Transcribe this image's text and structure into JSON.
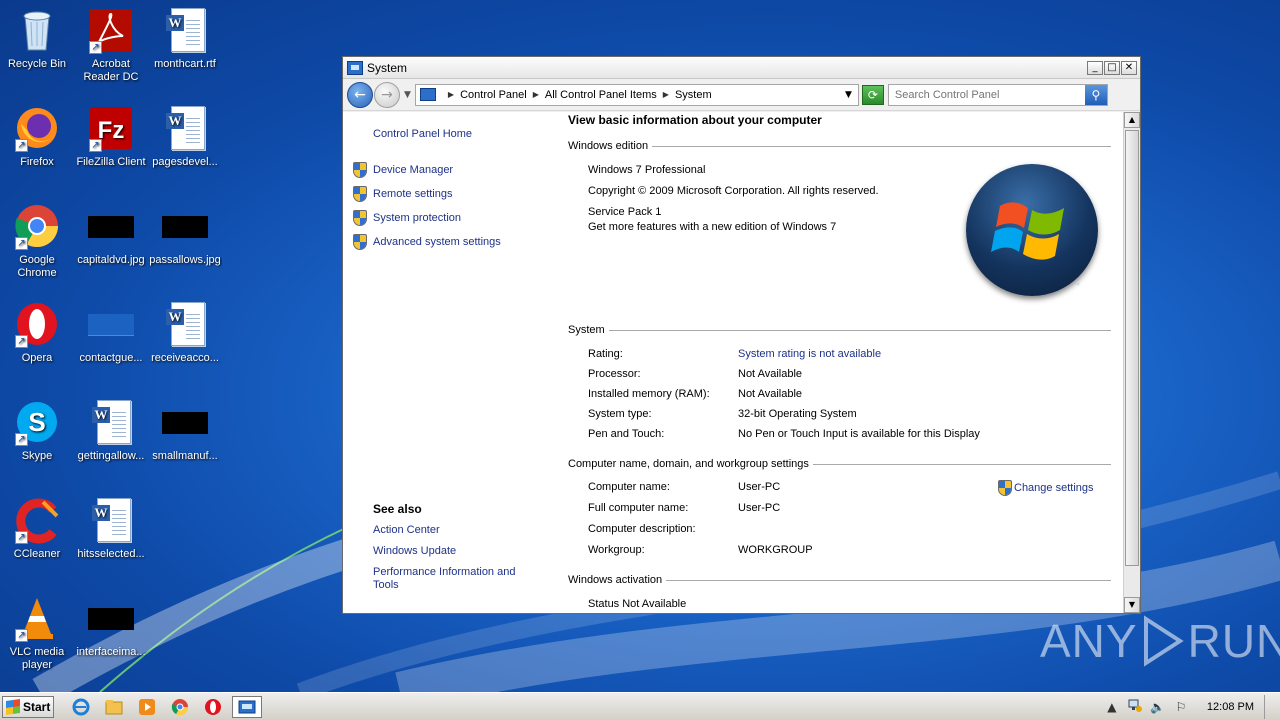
{
  "desktop": {
    "icons": [
      {
        "label": "Recycle Bin",
        "icon": "recycle-bin-icon"
      },
      {
        "label": "Acrobat Reader DC",
        "icon": "acrobat-icon"
      },
      {
        "label": "monthcart.rtf",
        "icon": "word-doc-icon"
      },
      {
        "label": "Firefox",
        "icon": "firefox-icon"
      },
      {
        "label": "FileZilla Client",
        "icon": "filezilla-icon"
      },
      {
        "label": "pagesdevel...",
        "icon": "word-doc-icon"
      },
      {
        "label": "Google Chrome",
        "icon": "chrome-icon"
      },
      {
        "label": "capitaldvd.jpg",
        "icon": "image-thumb-icon"
      },
      {
        "label": "passallows.jpg",
        "icon": "image-thumb-icon"
      },
      {
        "label": "Opera",
        "icon": "opera-icon"
      },
      {
        "label": "contactgue...",
        "icon": "image-thumb-icon"
      },
      {
        "label": "receiveacco...",
        "icon": "word-doc-icon"
      },
      {
        "label": "Skype",
        "icon": "skype-icon"
      },
      {
        "label": "gettingallow...",
        "icon": "word-doc-icon"
      },
      {
        "label": "smallmanuf...",
        "icon": "image-thumb-icon"
      },
      {
        "label": "CCleaner",
        "icon": "ccleaner-icon"
      },
      {
        "label": "hitsselected...",
        "icon": "word-doc-icon"
      },
      {
        "label": "VLC media player",
        "icon": "vlc-icon"
      },
      {
        "label": "interfaceima...",
        "icon": "image-thumb-icon"
      }
    ]
  },
  "window": {
    "title": "System",
    "buttons": {
      "minimize": "_",
      "maximize": "□",
      "close": "✕"
    },
    "address": {
      "crumbs": [
        "Control Panel",
        "All Control Panel Items",
        "System"
      ]
    },
    "search": {
      "placeholder": "Search Control Panel"
    }
  },
  "leftpane": {
    "home_link": "Control Panel Home",
    "tasks": [
      "Device Manager",
      "Remote settings",
      "System protection",
      "Advanced system settings"
    ],
    "see_also_title": "See also",
    "see_also": [
      "Action Center",
      "Windows Update",
      "Performance Information and Tools"
    ]
  },
  "main": {
    "heading": "View basic information about your computer",
    "edition": {
      "title": "Windows edition",
      "name": "Windows 7 Professional",
      "copyright": "Copyright © 2009 Microsoft Corporation.  All rights reserved.",
      "service_pack": "Service Pack 1",
      "upgrade_link": "Get more features with a new edition of Windows 7"
    },
    "system": {
      "title": "System",
      "rows": [
        {
          "label": "Rating:",
          "value": "System rating is not available"
        },
        {
          "label": "Processor:",
          "value": "Not Available"
        },
        {
          "label": "Installed memory (RAM):",
          "value": "Not Available"
        },
        {
          "label": "System type:",
          "value": "32-bit Operating System"
        },
        {
          "label": "Pen and Touch:",
          "value": "No Pen or Touch Input is available for this Display"
        }
      ]
    },
    "computer": {
      "title": "Computer name, domain, and workgroup settings",
      "change_link": "Change settings",
      "rows": [
        {
          "label": "Computer name:",
          "value": "User-PC"
        },
        {
          "label": "Full computer name:",
          "value": "User-PC"
        },
        {
          "label": "Computer description:",
          "value": ""
        },
        {
          "label": "Workgroup:",
          "value": "WORKGROUP"
        }
      ]
    },
    "activation": {
      "title": "Windows activation",
      "status": "Status Not Available"
    }
  },
  "taskbar": {
    "start_label": "Start",
    "clock": "12:08 PM"
  },
  "watermark": {
    "left": "ANY",
    "right": "RUN"
  }
}
